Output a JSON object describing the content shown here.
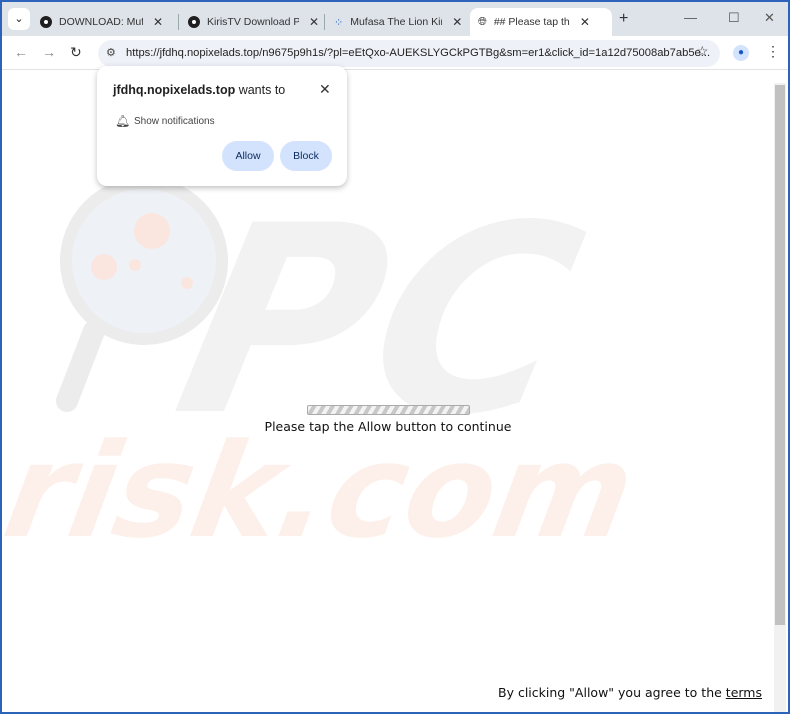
{
  "tabs": [
    {
      "label": "DOWNLOAD: Mufasa",
      "icon": "circle-logo-icon"
    },
    {
      "label": "KirisTV Download Page",
      "icon": "circle-logo-icon"
    },
    {
      "label": "Mufasa The Lion King",
      "icon": "loading-spinner-icon"
    },
    {
      "label": "## Please tap the Allow",
      "icon": "globe-icon",
      "active": true
    }
  ],
  "toolbar": {
    "url": "https://jfdhq.nopixelads.top/n9675p9h1s/?pl=eEtQxo-AUEKSLYGCkPGTBg&sm=er1&click_id=1a12d75008ab7ab5e..."
  },
  "popup": {
    "site": "jfdhq.nopixelads.top",
    "wants": "wants to",
    "permission": "Show notifications",
    "allow": "Allow",
    "block": "Block"
  },
  "page": {
    "message": "Please tap the Allow button to continue",
    "footer_prefix": "By clicking \"Allow\" you agree to the",
    "footer_link": "terms",
    "watermark": "PC risk.com"
  },
  "colors": {
    "accent": "#2d63b8",
    "button_bg": "#d3e3fd"
  }
}
